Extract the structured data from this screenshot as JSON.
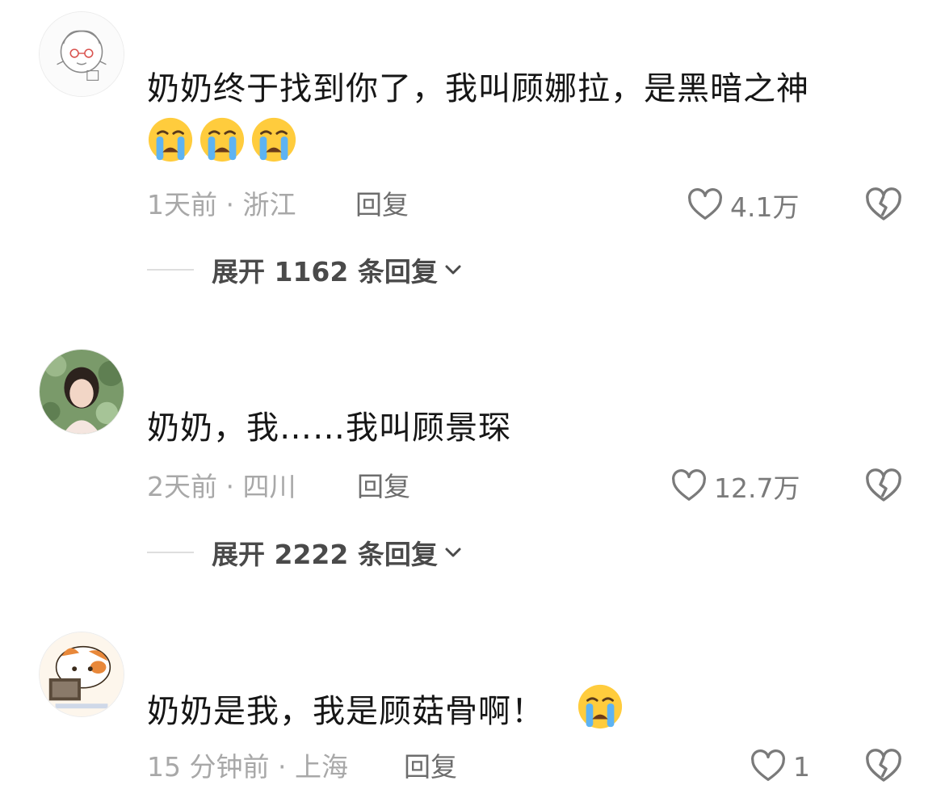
{
  "comments": [
    {
      "text": "奶奶终于找到你了，我叫顾娜拉，是黑暗之神",
      "emoji_count": 3,
      "meta": "1天前 · 浙江",
      "reply_label": "回复",
      "likes": "4.1万",
      "expand_label": "展开 1162 条回复"
    },
    {
      "text": "奶奶，我……我叫顾景琛",
      "meta": "2天前 · 四川",
      "reply_label": "回复",
      "likes": "12.7万",
      "expand_label": "展开 2222 条回复"
    },
    {
      "text": "奶奶是我，我是顾菇骨啊！",
      "emoji_count": 1,
      "meta": "15 分钟前 · 上海",
      "reply_label": "回复",
      "likes": "1"
    }
  ],
  "icons": {
    "emoji": "loudly-crying-face-icon",
    "like": "heart-outline-icon",
    "dislike": "broken-heart-icon",
    "expand": "chevron-down-icon"
  },
  "colors": {
    "text": "#161616",
    "meta": "#a8a8a8",
    "reply": "#6d6d6d",
    "icon": "#7a7a7a",
    "emoji_face": "#ffcc3d",
    "emoji_tears": "#5db3f2"
  }
}
